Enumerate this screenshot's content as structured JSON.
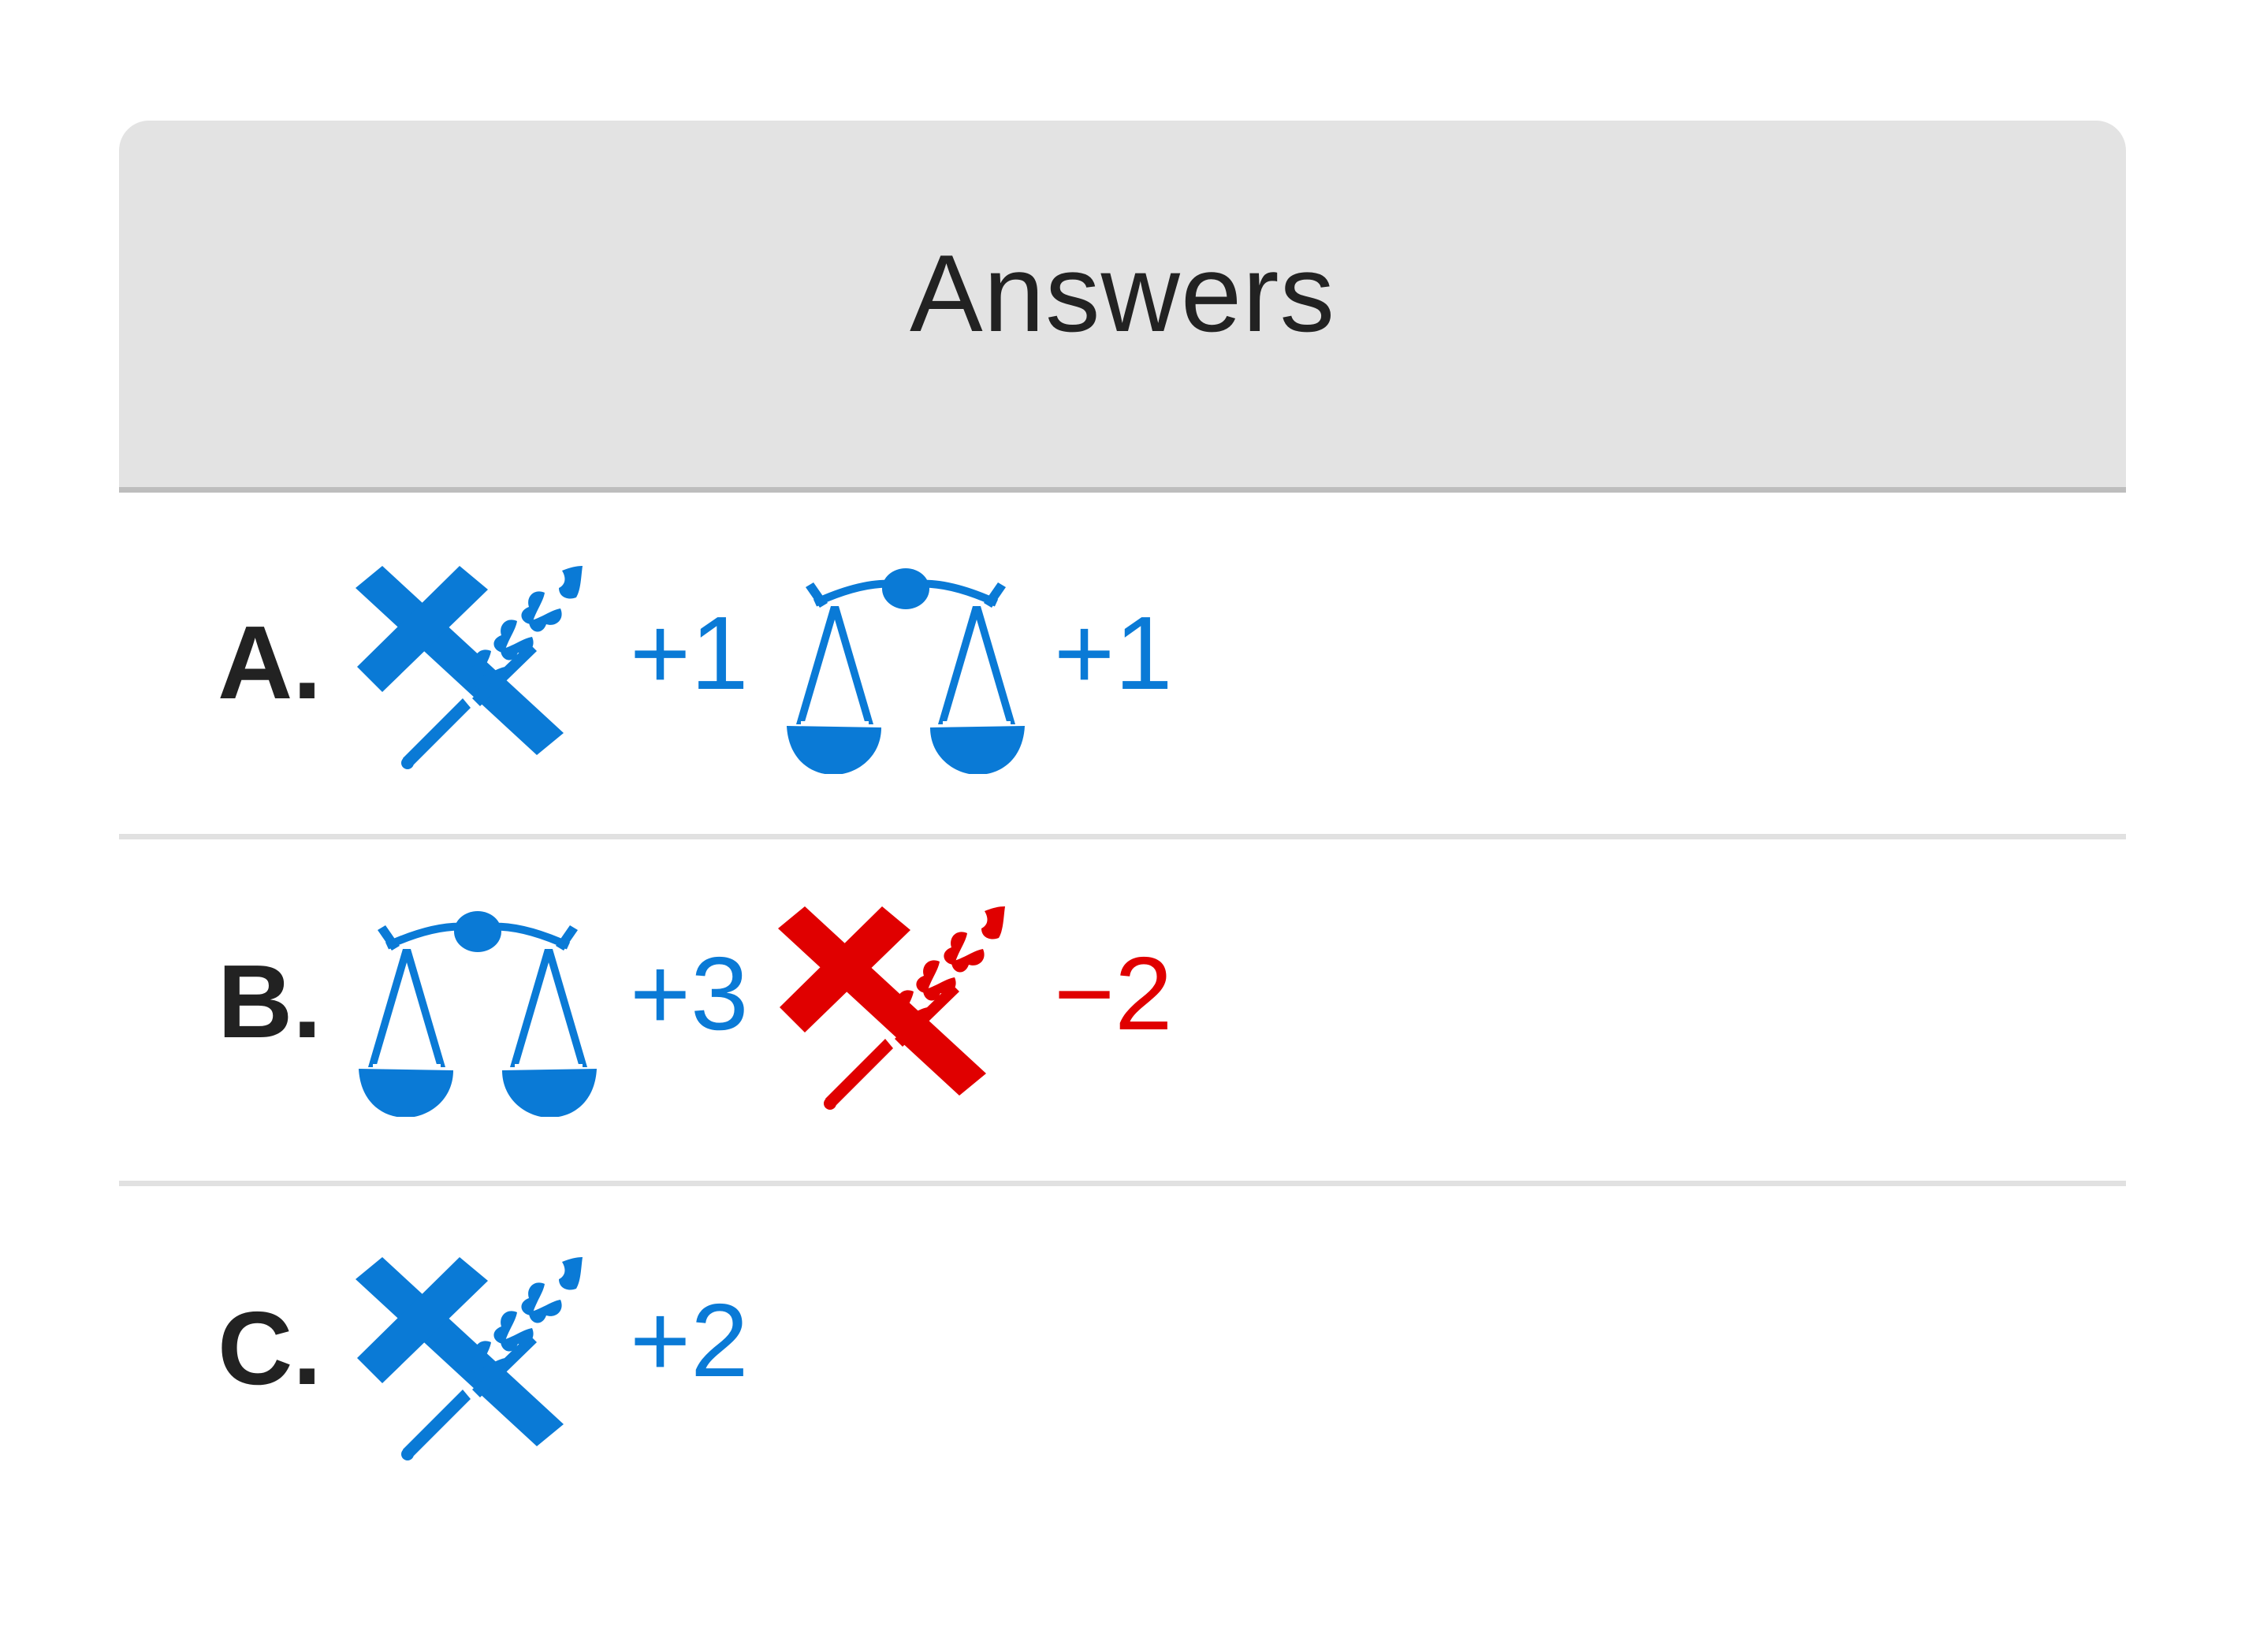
{
  "header": {
    "title": "Answers"
  },
  "colors": {
    "positive": "#0a7ad6",
    "negative": "#e00000",
    "header_bg": "#e3e3e3"
  },
  "answers": [
    {
      "letter": "A.",
      "effects": [
        {
          "icon": "hammer-and-wheat-icon",
          "color": "blue",
          "value": "+1"
        },
        {
          "icon": "scales-icon",
          "color": "blue",
          "value": "+1"
        }
      ]
    },
    {
      "letter": "B.",
      "effects": [
        {
          "icon": "scales-icon",
          "color": "blue",
          "value": "+3"
        },
        {
          "icon": "hammer-and-wheat-icon",
          "color": "red",
          "value": "−2"
        }
      ]
    },
    {
      "letter": "C.",
      "effects": [
        {
          "icon": "hammer-and-wheat-icon",
          "color": "blue",
          "value": "+2"
        }
      ]
    }
  ]
}
